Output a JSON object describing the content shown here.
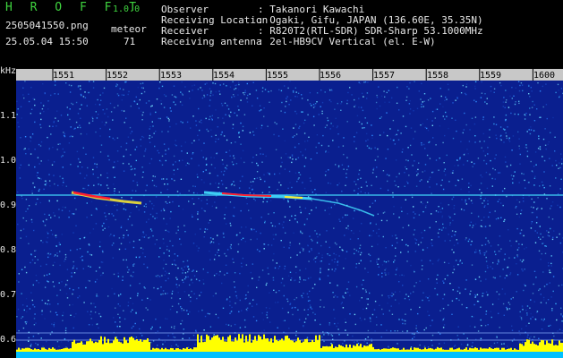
{
  "header": {
    "logo": "H R O F F T",
    "version": "1.0.0",
    "filename": "2505041550.png",
    "datetime": "25.05.04 15:50",
    "meteor_label": "meteor",
    "meteor_count": "71",
    "info": [
      {
        "key": "Observer",
        "value": ": Takanori Kawachi"
      },
      {
        "key": "Receiving Location",
        "value": ": Ogaki, Gifu, JAPAN (136.60E, 35.35N)"
      },
      {
        "key": "Receiver",
        "value": ": R820T2(RTL-SDR) SDR-Sharp 53.1000MHz"
      },
      {
        "key": "Receiving antenna",
        "value": ": 2el-HB9CV Vertical (el. E-W)"
      }
    ]
  },
  "colors": {
    "background": "#000000",
    "spectrum_bg": "#0a1f8f",
    "axis_bar": "#c8c8c8",
    "signal_band": "#44e0ff",
    "meteor_hot": "#ff2030",
    "meteor_mid": "#ffee30",
    "level_bars": "#ffff00",
    "level_base": "#00c0ff",
    "header_green": "#3fd43f"
  },
  "chart_data": {
    "type": "heatmap",
    "yunit": "kHz",
    "yticks": [
      "1.1",
      "1.0",
      "0.9",
      "0.8",
      "0.7",
      "0.6"
    ],
    "xticks": [
      "1551",
      "1552",
      "1553",
      "1554",
      "1555",
      "1556",
      "1557",
      "1558",
      "1559",
      "1600"
    ],
    "carrier_khz": 0.92
  }
}
